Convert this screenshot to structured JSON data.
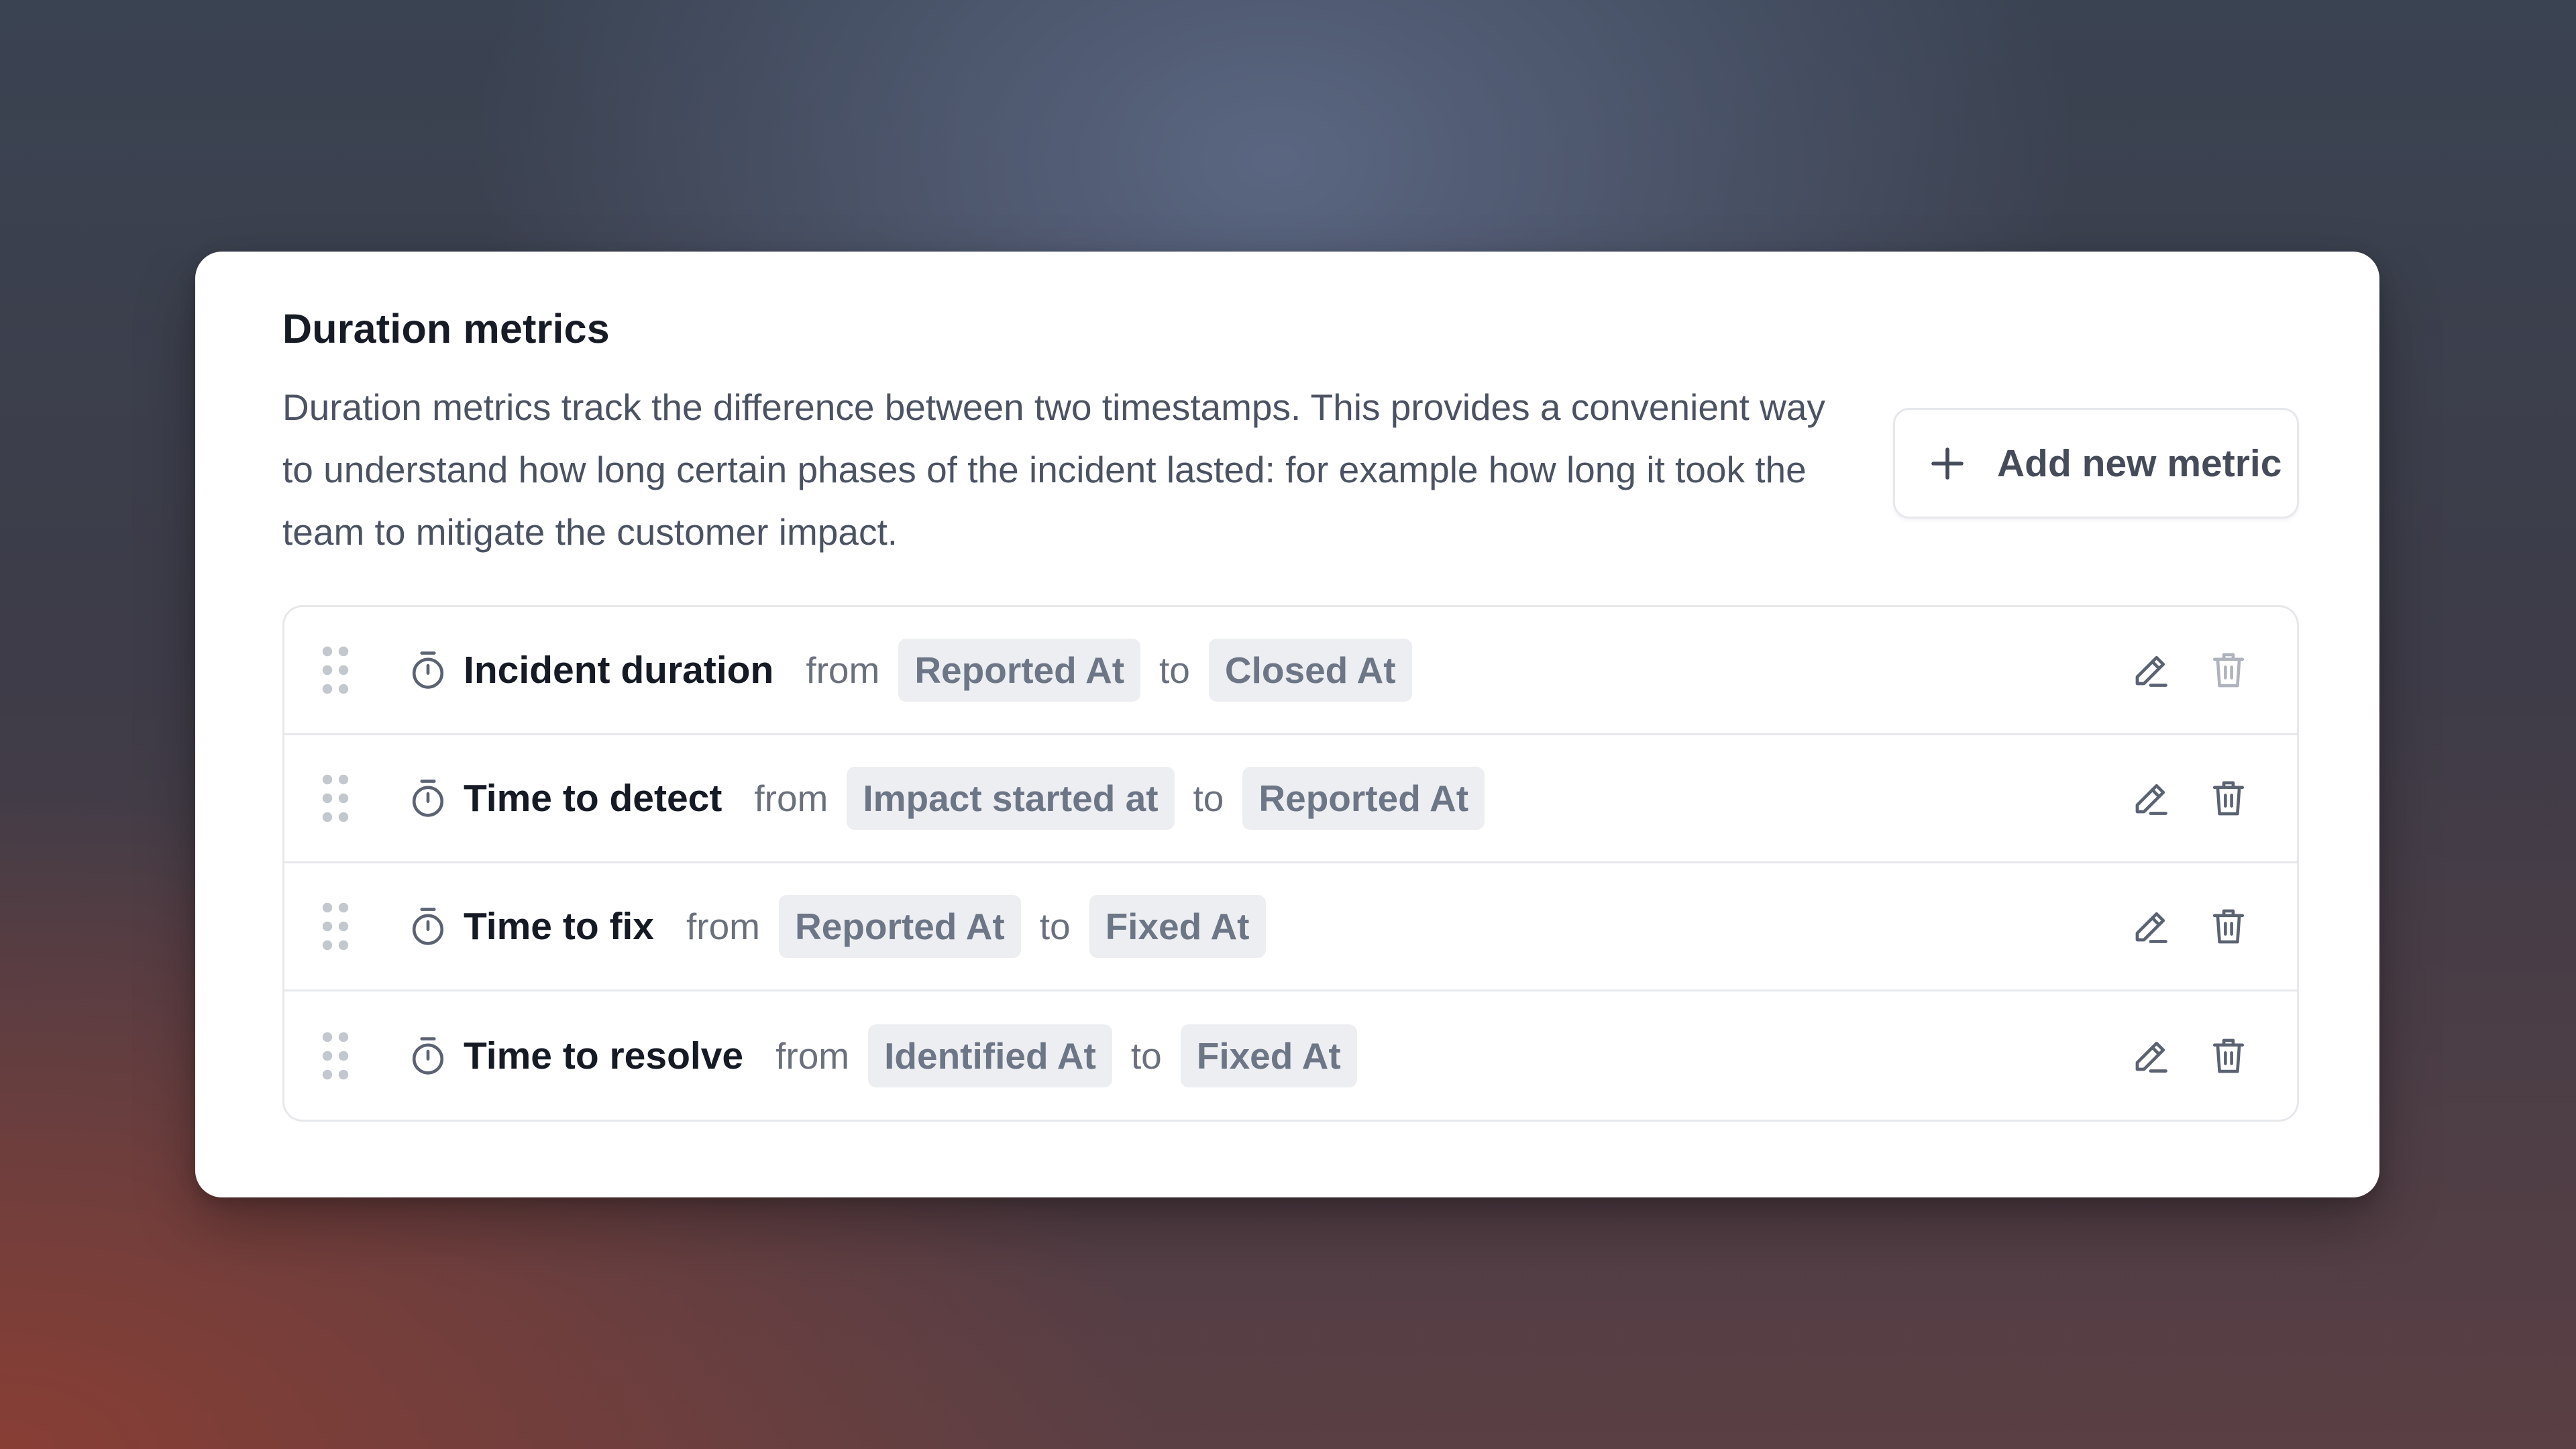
{
  "section": {
    "title": "Duration metrics",
    "description": "Duration metrics track the difference between two timestamps. This provides a convenient way to understand how long certain phases of the incident lasted: for example how long it took the team to mitigate the customer impact.",
    "add_button_label": "Add new metric"
  },
  "metrics": [
    {
      "name": "Incident duration",
      "from_word": "from",
      "from": "Reported At",
      "to_word": "to",
      "to": "Closed At",
      "delete_disabled": true
    },
    {
      "name": "Time to detect",
      "from_word": "from",
      "from": "Impact started at",
      "to_word": "to",
      "to": "Reported At",
      "delete_disabled": false
    },
    {
      "name": "Time to fix",
      "from_word": "from",
      "from": "Reported At",
      "to_word": "to",
      "to": "Fixed At",
      "delete_disabled": false
    },
    {
      "name": "Time to resolve",
      "from_word": "from",
      "from": "Identified At",
      "to_word": "to",
      "to": "Fixed At",
      "delete_disabled": false
    }
  ],
  "icons": {
    "add": "plus-icon",
    "drag": "drag-handle-icon",
    "timer": "stopwatch-icon",
    "edit": "pencil-icon",
    "delete": "trash-icon"
  },
  "colors": {
    "chip_background": "#eceef1",
    "chip_text": "#6d7686",
    "icon": "#5b6271",
    "icon_disabled": "#aeb3bc",
    "drag_handle": "#c3c7ce"
  }
}
